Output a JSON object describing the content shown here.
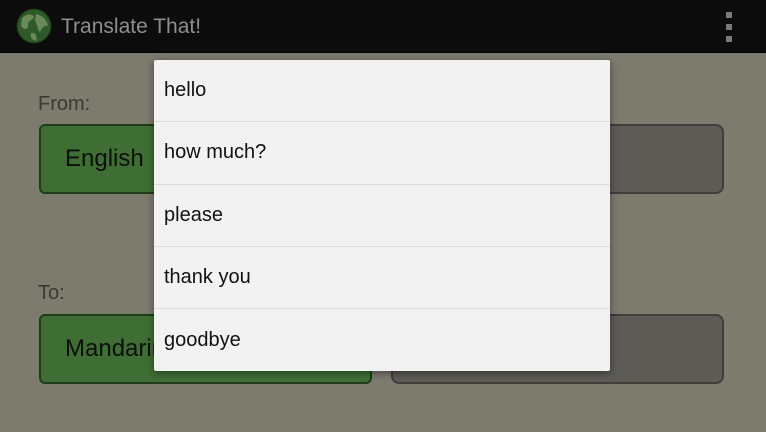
{
  "app": {
    "title": "Translate That!",
    "icon": "globe-icon",
    "menu_icon": "overflow-menu-icon"
  },
  "form": {
    "from_label": "From:",
    "from_language": "English",
    "to_label": "To:",
    "to_language": "Mandarin"
  },
  "phrase_menu": {
    "items": [
      "hello",
      "how much?",
      "please",
      "thank you",
      "goodbye"
    ]
  },
  "colors": {
    "action_bar": "#0c0c0c",
    "language_button": "#3f6e34",
    "popup_background": "#f2f2f2",
    "dim_overlay": "#7d7a6e"
  }
}
